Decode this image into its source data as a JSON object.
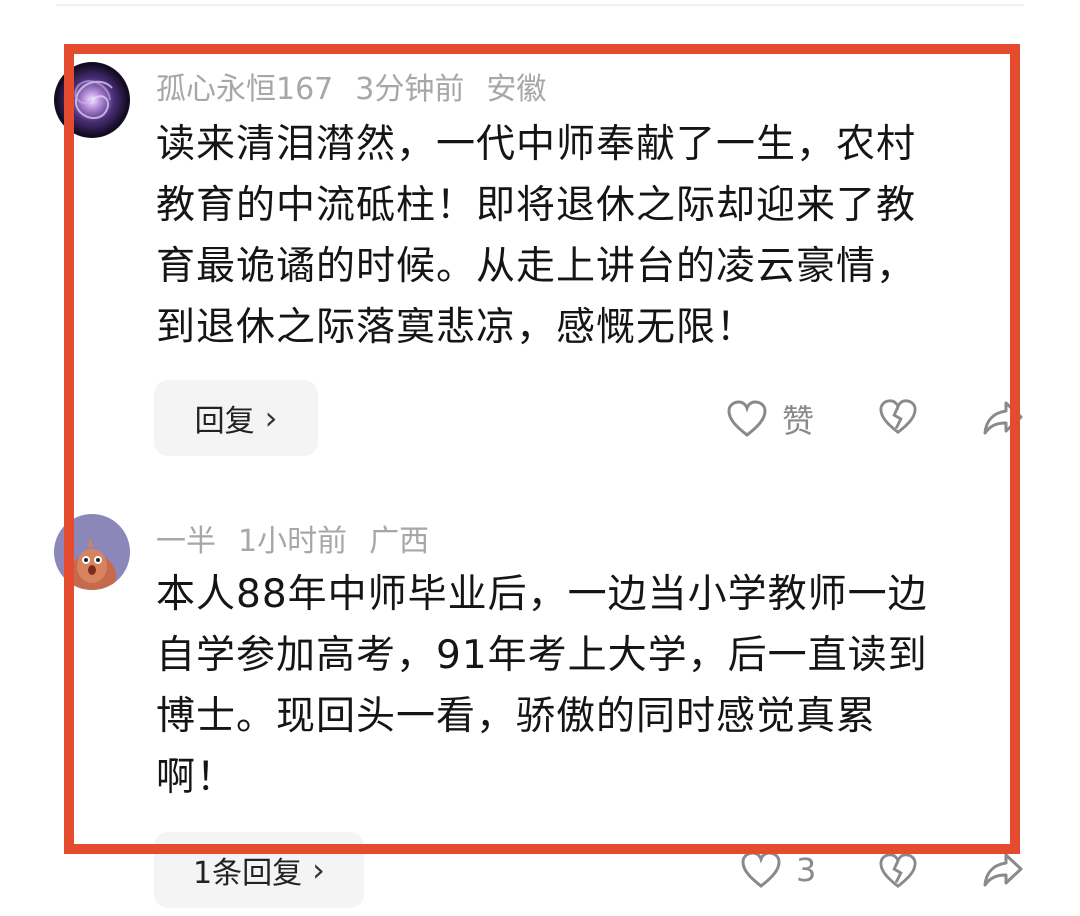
{
  "comments": [
    {
      "username": "孤心永恒167",
      "time": "3分钟前",
      "location": "安徽",
      "lines": [
        "读来清泪潸然，一代中师奉献了一生，农村",
        "教育的中流砥柱！即将退休之际却迎来了教",
        "育最诡谲的时候。从走上讲台的凌云豪情，",
        "到退休之际落寞悲凉，感慨无限！"
      ],
      "reply_label": "回复",
      "like_label": "赞"
    },
    {
      "username": "一半",
      "time": "1小时前",
      "location": "广西",
      "lines": [
        "本人88年中师毕业后，一边当小学教师一边",
        "自学参加高考，91年考上大学，后一直读到",
        "博士。现回头一看，骄傲的同时感觉真累",
        "啊！"
      ],
      "reply_label": "1条回复",
      "like_count": "3"
    }
  ],
  "colors": {
    "highlight": "#e54b2e",
    "meta_text": "#a7a7a7",
    "button_bg": "#f4f4f4"
  },
  "icons": [
    "avatar-galaxy",
    "avatar-cartoon",
    "chevron-right-icon",
    "heart-icon",
    "broken-heart-icon",
    "share-icon"
  ]
}
